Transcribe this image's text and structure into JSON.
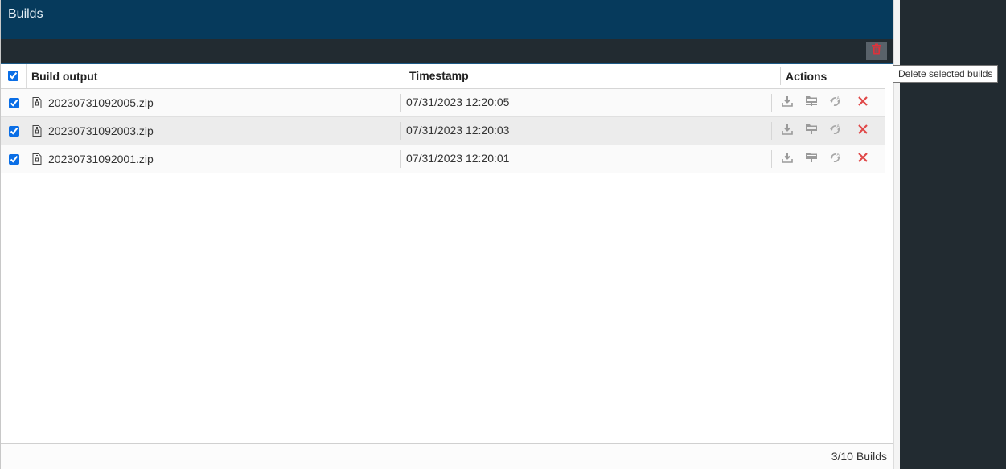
{
  "header": {
    "title": "Builds"
  },
  "toolbar": {
    "delete_selected_icon": "trash-icon",
    "delete_selected_tooltip": "Delete selected builds"
  },
  "table": {
    "columns": [
      "Build output",
      "Timestamp",
      "Actions"
    ],
    "select_all_checked": true,
    "rows": [
      {
        "checked": true,
        "name": "20230731092005.zip",
        "timestamp": "07/31/2023 12:20:05"
      },
      {
        "checked": true,
        "name": "20230731092003.zip",
        "timestamp": "07/31/2023 12:20:03"
      },
      {
        "checked": true,
        "name": "20230731092001.zip",
        "timestamp": "07/31/2023 12:20:01"
      }
    ],
    "row_actions": [
      {
        "icon": "download-icon",
        "label": "Download"
      },
      {
        "icon": "deploy-folder-icon",
        "label": "Deploy"
      },
      {
        "icon": "regenerate-icon",
        "label": "Regenerate"
      },
      {
        "icon": "delete-icon",
        "label": "Delete"
      }
    ]
  },
  "footer": {
    "count_text": "3/10 Builds"
  },
  "colors": {
    "title_bar": "#063a5c",
    "toolbar": "#222b31",
    "delete_red": "#e04848",
    "accent_checkbox": "#0a6ee6"
  }
}
